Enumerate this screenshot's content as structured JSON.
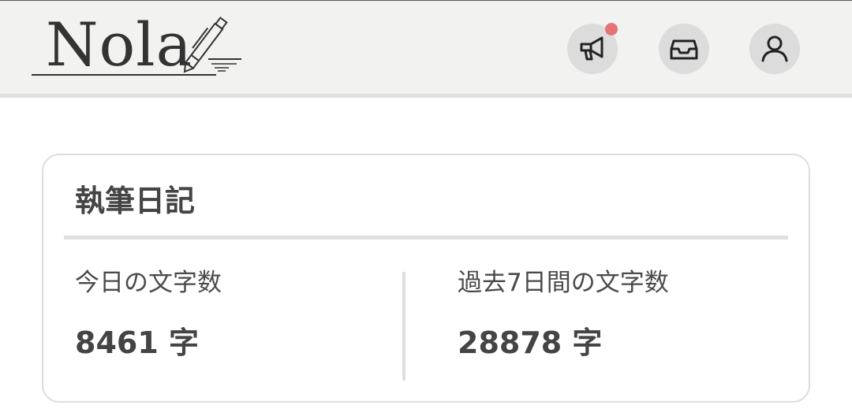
{
  "header": {
    "logo_text": "Nola",
    "icons": {
      "announcement": "megaphone-icon",
      "inbox": "inbox-tray-icon",
      "account": "user-icon"
    },
    "notification_dot_color": "#e57373"
  },
  "diary": {
    "title": "執筆日記",
    "today_label": "今日の文字数",
    "today_value": "8461 字",
    "week_label": "過去7日間の文字数",
    "week_value": "28878 字"
  }
}
